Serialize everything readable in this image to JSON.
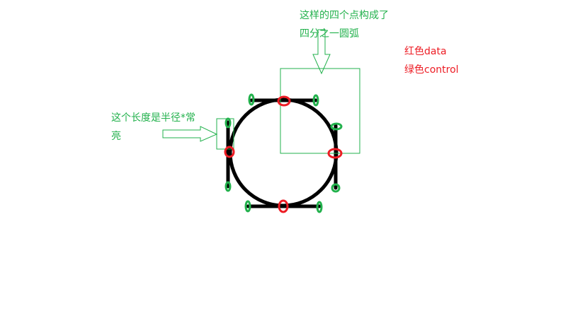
{
  "annotations": {
    "top_line1": "这样的四个点构成了",
    "top_line2": "四分之一圆弧",
    "left_line1": "这个长度是半径*常",
    "left_line2": "亮"
  },
  "legend": {
    "red_label": "红色data",
    "green_label": "绿色control"
  },
  "colors": {
    "green": "#22b14c",
    "red": "#ed1c24",
    "stroke": "#000000"
  }
}
